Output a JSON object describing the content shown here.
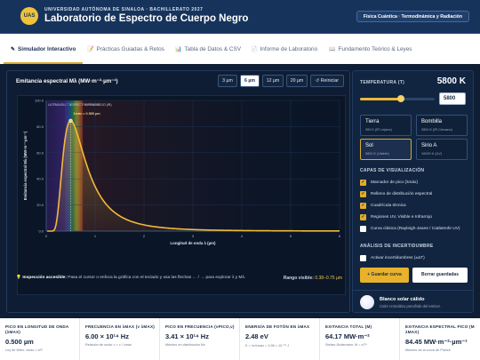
{
  "header": {
    "subtitle": "UNIVERSIDAD AUTÓNOMA DE SINALOA · BACHILLERATO 2027",
    "title": "Laboratorio de Espectro de Cuerpo Negro",
    "logo": "UAS",
    "badge": "Física Cuántica · Termodinámica y Radiación"
  },
  "tabs": [
    {
      "label": "Simulador Interactivo",
      "icon": "✎"
    },
    {
      "label": "Prácticas Guiadas & Retos",
      "icon": "📝"
    },
    {
      "label": "Tabla de Datos & CSV",
      "icon": "📊"
    },
    {
      "label": "Informe de Laboratorio",
      "icon": "📄"
    },
    {
      "label": "Fundamento Teórico & Leyes",
      "icon": "📖"
    }
  ],
  "chart_panel": {
    "title": "Emitancia espectral Mλ (MW·m⁻²·µm⁻¹)",
    "ranges": [
      "3 µm",
      "6 µm",
      "12 µm",
      "20 µm"
    ],
    "reset": "↺ Reiniciar",
    "hint_bold": "Inspección accesible:",
    "hint_text": "Pasa el cursor o enfoca la gráfica con el teclado y usa las flechas ← / → para explorar λ y Mλ.",
    "range_label": "Rango visible:",
    "range_value": "0.38–0.75 µm"
  },
  "chart_data": {
    "type": "line",
    "temperature_K": 5800,
    "xlabel": "Longitud de onda λ (µm)",
    "ylabel": "Emitancia espectral Mλ (MW·m⁻²·µm⁻¹)",
    "xlim": [
      0,
      6
    ],
    "ylim": [
      0,
      100
    ],
    "xticks": [
      0,
      1,
      2,
      3,
      4,
      5,
      6
    ],
    "yticks": [
      0,
      20,
      40,
      60,
      80,
      100
    ],
    "peak_lambda_um": 0.5,
    "peak_value": 84.45,
    "peak_label": "λmáx = 0.500 µm",
    "regions": [
      {
        "name": "ULTRAVIOLETA",
        "from": 0,
        "to": 0.38
      },
      {
        "name": "ESPECTRO VISIBLE",
        "from": 0.38,
        "to": 0.75
      },
      {
        "name": "INFRARROJO (IR)",
        "from": 0.75,
        "to": 6
      }
    ],
    "grid": true,
    "colors": {
      "curve": "#f2b93a",
      "marker": "#f4d27a"
    }
  },
  "sidebar": {
    "temp_label": "TEMPERATURA (T)",
    "temp_value": "5800 K",
    "temp_input": "5800",
    "slider_fraction": 0.55,
    "presets": [
      {
        "name": "Tierra",
        "sub": "300 K (IR Lejano)"
      },
      {
        "name": "Bombilla",
        "sub": "2800 K (IR Cercano)"
      },
      {
        "name": "Sol",
        "sub": "5800 K (Visible)"
      },
      {
        "name": "Sirio A",
        "sub": "10000 K (UV)"
      }
    ],
    "layers_label": "CAPAS DE VISUALIZACIÓN",
    "layers": [
      {
        "label": "Marcador de pico (λmáx)",
        "checked": true
      },
      {
        "label": "Relleno de distribución espectral",
        "checked": true
      },
      {
        "label": "Cuadrícula técnica",
        "checked": true
      },
      {
        "label": "Regiones UV, Visible e Infrarrojo",
        "checked": true
      },
      {
        "label": "Curva clásica (Rayleigh-Jeans / Catástrofe UV)",
        "checked": false
      }
    ],
    "unc_label": "ANÁLISIS DE INCERTIDUMBRE",
    "unc_check": "Activar incertidumbres (±ΔT)",
    "save": "+ Guardar curva",
    "clear": "Borrar guardadas",
    "star_name": "Blanco solar cálido",
    "star_desc": "Color cromático percibido del emisor."
  },
  "stats": [
    {
      "label": "PICO EN LONGITUD DE ONDA (λMAX)",
      "value": "0.500 µm",
      "note": "Ley de Wien: λmáx = b/T"
    },
    {
      "label": "FRECUENCIA EN λMAX (ν λMAX)",
      "value": "6.00 × 10¹⁴ Hz",
      "note": "Relación de onda: ν = c / λmáx"
    },
    {
      "label": "PICO EN FRECUENCIA (νPICO,ν)",
      "value": "3.41 × 10¹⁴ Hz",
      "note": "Máximo en distribución Mν"
    },
    {
      "label": "ENERGÍA DE FOTÓN EN λMAX",
      "value": "2.48 eV",
      "note": "E = hc/λmáx = 3.96 × 10⁻¹⁹ J"
    },
    {
      "label": "EXITANCIA TOTAL (M)",
      "value": "64.17 MW·m⁻²",
      "note": "Stefan–Boltzmann: M = σT⁴"
    },
    {
      "label": "EXITANCIA ESPECTRAL PICO (M λMAX)",
      "value": "84.45 MW·m⁻²·µm⁻¹",
      "note": "Máximo de la curva de Planck"
    }
  ]
}
